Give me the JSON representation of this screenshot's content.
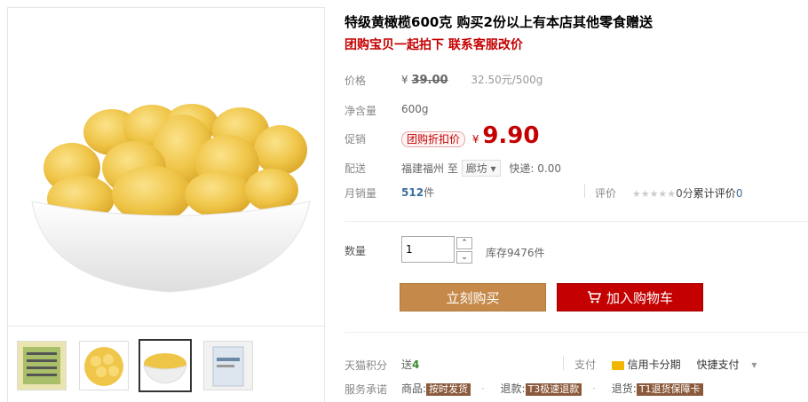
{
  "product": {
    "title": "特级黄橄榄600克 购买2份以上有本店其他零食赠送",
    "subtitle": "团购宝贝一起拍下 联系客服改价"
  },
  "price": {
    "label": "价格",
    "currency": "¥",
    "original": "39.00",
    "unit_price": "32.50元/500g"
  },
  "net_weight": {
    "label": "净含量",
    "value": "600g"
  },
  "promo": {
    "label": "促销",
    "tag": "团购折扣价",
    "currency": "¥",
    "price": "9.90"
  },
  "shipping": {
    "label": "配送",
    "from": "福建福州",
    "to_word": "至",
    "destination": "廊坊",
    "express": "快递: 0.00"
  },
  "sales": {
    "label": "月销量",
    "count": "512",
    "unit": "件",
    "review_label": "评价",
    "stars": "★★★★★",
    "rating_text": "0分",
    "review_text": "累计评价",
    "review_count": "0"
  },
  "quantity": {
    "label": "数量",
    "value": "1",
    "stock": "库存9476件",
    "up_arrow": "⌃",
    "down_arrow": "⌄"
  },
  "actions": {
    "buy_now": "立刻购买",
    "add_cart": "加入购物车"
  },
  "points": {
    "label": "天猫积分",
    "prefix": "送",
    "value": "4",
    "pay_label": "支付",
    "credit": "信用卡分期",
    "quick": "快捷支付"
  },
  "service": {
    "label": "服务承诺",
    "goods": "商品:",
    "goods_badge": "按时发货",
    "refund": "退款:",
    "refund_badge": "T3极速退款",
    "return": "退货:",
    "return_badge": "T1退货保障卡"
  },
  "colors": {
    "accent_red": "#c40000",
    "buy_button": "#c58a4a",
    "count_blue": "#3c6e9e"
  }
}
